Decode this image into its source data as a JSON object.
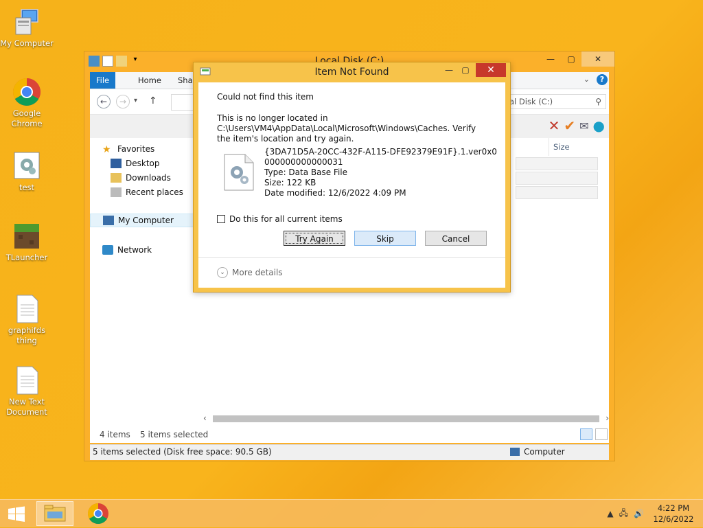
{
  "desktop": {
    "icons": [
      {
        "label": "My Computer"
      },
      {
        "label": "Google Chrome"
      },
      {
        "label": "test"
      },
      {
        "label": "TLauncher"
      },
      {
        "label": "graphifds thing"
      },
      {
        "label": "New Text Document"
      }
    ]
  },
  "explorer": {
    "title": "Local Disk (C:)",
    "tabs": {
      "file": "File",
      "home": "Home",
      "share": "Shar"
    },
    "search_text": "al Disk (C:)",
    "column_size": "Size",
    "nav": {
      "favorites": "Favorites",
      "desktop": "Desktop",
      "downloads": "Downloads",
      "recent": "Recent places",
      "my_computer": "My Computer",
      "network": "Network"
    },
    "status_items": "4 items",
    "status_selected": "5 items selected",
    "status_bar_left": "5 items selected (Disk free space: 90.5 GB)",
    "status_bar_right": "Computer"
  },
  "dialog": {
    "title": "Item Not Found",
    "heading": "Could not find this item",
    "message_line1": "This is no longer located in",
    "message_line2": "C:\\Users\\VM4\\AppData\\Local\\Microsoft\\Windows\\Caches. Verify the item's location and try again.",
    "file_name": "{3DA71D5A-20CC-432F-A115-DFE92379E91F}.1.ver0x0000000000000031",
    "file_type": "Type: Data Base File",
    "file_size": "Size: 122 KB",
    "file_modified": "Date modified: 12/6/2022 4:09 PM",
    "checkbox_label": "Do this for all current items",
    "btn_try_again": "Try Again",
    "btn_skip": "Skip",
    "btn_cancel": "Cancel",
    "more_details": "More details"
  },
  "taskbar": {
    "time": "4:22 PM",
    "date": "12/6/2022"
  },
  "colors": {
    "accent": "#1979ca",
    "dialog_frame": "#f7c34a",
    "close_red": "#c7382b"
  }
}
